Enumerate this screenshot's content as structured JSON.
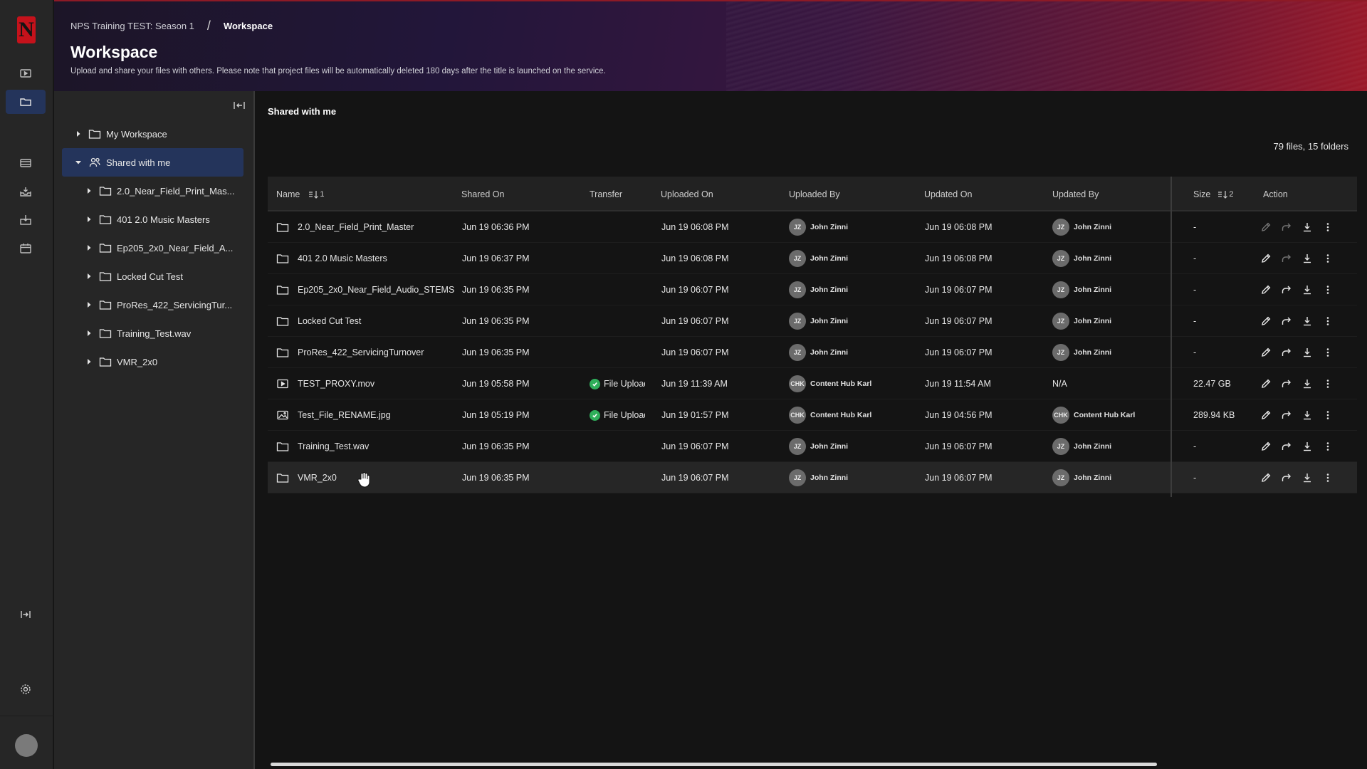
{
  "app": {
    "logo_letter": "N"
  },
  "rail": {
    "items": [
      {
        "icon": "play-icon"
      },
      {
        "icon": "folder-icon"
      },
      {
        "icon": "film-icon"
      },
      {
        "icon": "inbox-icon"
      },
      {
        "icon": "download-tray-icon"
      },
      {
        "icon": "calendar-icon"
      },
      {
        "icon": "expand-panel-icon"
      },
      {
        "icon": "gear-icon"
      }
    ]
  },
  "header": {
    "breadcrumb": [
      "NPS Training TEST: Season 1",
      "Workspace"
    ],
    "separator": "/",
    "title": "Workspace",
    "description": "Upload and share your files with others. Please note that project files will be automatically deleted 180 days after the title is launched on the service."
  },
  "tree": {
    "items": [
      {
        "label": "My Workspace",
        "level": 0,
        "expanded": false,
        "icon": "folder-icon"
      },
      {
        "label": "Shared with me",
        "level": 0,
        "expanded": true,
        "icon": "shared-users-icon",
        "selected": true
      },
      {
        "label": "2.0_Near_Field_Print_Mas...",
        "level": 1,
        "icon": "folder-icon"
      },
      {
        "label": "401 2.0 Music Masters",
        "level": 1,
        "icon": "folder-icon"
      },
      {
        "label": "Ep205_2x0_Near_Field_A...",
        "level": 1,
        "icon": "folder-icon"
      },
      {
        "label": "Locked Cut Test",
        "level": 1,
        "icon": "folder-icon"
      },
      {
        "label": "ProRes_422_ServicingTur...",
        "level": 1,
        "icon": "folder-icon"
      },
      {
        "label": "Training_Test.wav",
        "level": 1,
        "icon": "folder-icon"
      },
      {
        "label": "VMR_2x0",
        "level": 1,
        "icon": "folder-icon"
      }
    ]
  },
  "main": {
    "section_title": "Shared with me",
    "counts": "79 files, 15 folders",
    "columns": {
      "name": "Name",
      "name_sort": "1",
      "shared_on": "Shared On",
      "transfer": "Transfer",
      "uploaded_on": "Uploaded On",
      "uploaded_by": "Uploaded By",
      "updated_on": "Updated On",
      "updated_by": "Updated By",
      "size": "Size",
      "size_sort": "2",
      "action": "Action"
    },
    "rows": [
      {
        "type": "folder",
        "name": "2.0_Near_Field_Print_Master",
        "shared_on": "Jun 19 06:36 PM",
        "transfer": "",
        "uploaded_on": "Jun 19 06:08 PM",
        "uploaded_by_initials": "JZ",
        "uploaded_by": "John Zinni",
        "updated_on": "Jun 19 06:08 PM",
        "updated_by_initials": "JZ",
        "updated_by": "John Zinni",
        "size": "-",
        "edit_enabled": false,
        "share_enabled": false
      },
      {
        "type": "folder",
        "name": "401 2.0 Music Masters",
        "shared_on": "Jun 19 06:37 PM",
        "transfer": "",
        "uploaded_on": "Jun 19 06:08 PM",
        "uploaded_by_initials": "JZ",
        "uploaded_by": "John Zinni",
        "updated_on": "Jun 19 06:08 PM",
        "updated_by_initials": "JZ",
        "updated_by": "John Zinni",
        "size": "-",
        "edit_enabled": true,
        "share_enabled": false
      },
      {
        "type": "folder",
        "name": "Ep205_2x0_Near_Field_Audio_STEMS",
        "shared_on": "Jun 19 06:35 PM",
        "transfer": "",
        "uploaded_on": "Jun 19 06:07 PM",
        "uploaded_by_initials": "JZ",
        "uploaded_by": "John Zinni",
        "updated_on": "Jun 19 06:07 PM",
        "updated_by_initials": "JZ",
        "updated_by": "John Zinni",
        "size": "-",
        "edit_enabled": true,
        "share_enabled": true
      },
      {
        "type": "folder",
        "name": "Locked Cut Test",
        "shared_on": "Jun 19 06:35 PM",
        "transfer": "",
        "uploaded_on": "Jun 19 06:07 PM",
        "uploaded_by_initials": "JZ",
        "uploaded_by": "John Zinni",
        "updated_on": "Jun 19 06:07 PM",
        "updated_by_initials": "JZ",
        "updated_by": "John Zinni",
        "size": "-",
        "edit_enabled": true,
        "share_enabled": true
      },
      {
        "type": "folder",
        "name": "ProRes_422_ServicingTurnover",
        "shared_on": "Jun 19 06:35 PM",
        "transfer": "",
        "uploaded_on": "Jun 19 06:07 PM",
        "uploaded_by_initials": "JZ",
        "uploaded_by": "John Zinni",
        "updated_on": "Jun 19 06:07 PM",
        "updated_by_initials": "JZ",
        "updated_by": "John Zinni",
        "size": "-",
        "edit_enabled": true,
        "share_enabled": true
      },
      {
        "type": "video",
        "name": "TEST_PROXY.mov",
        "shared_on": "Jun 19 05:58 PM",
        "transfer": "File Upload",
        "uploaded_on": "Jun 19 11:39 AM",
        "uploaded_by_initials": "CHK",
        "uploaded_by": "Content Hub Karl",
        "updated_on": "Jun 19 11:54 AM",
        "updated_by_initials": "",
        "updated_by": "N/A",
        "size": "22.47 GB",
        "edit_enabled": true,
        "share_enabled": true
      },
      {
        "type": "image",
        "name": "Test_File_RENAME.jpg",
        "shared_on": "Jun 19 05:19 PM",
        "transfer": "File Upload",
        "uploaded_on": "Jun 19 01:57 PM",
        "uploaded_by_initials": "CHK",
        "uploaded_by": "Content Hub Karl",
        "updated_on": "Jun 19 04:56 PM",
        "updated_by_initials": "CHK",
        "updated_by": "Content Hub Karl",
        "size": "289.94 KB",
        "edit_enabled": true,
        "share_enabled": true
      },
      {
        "type": "folder",
        "name": "Training_Test.wav",
        "shared_on": "Jun 19 06:35 PM",
        "transfer": "",
        "uploaded_on": "Jun 19 06:07 PM",
        "uploaded_by_initials": "JZ",
        "uploaded_by": "John Zinni",
        "updated_on": "Jun 19 06:07 PM",
        "updated_by_initials": "JZ",
        "updated_by": "John Zinni",
        "size": "-",
        "edit_enabled": true,
        "share_enabled": true
      },
      {
        "type": "folder",
        "name": "VMR_2x0",
        "shared_on": "Jun 19 06:35 PM",
        "transfer": "",
        "uploaded_on": "Jun 19 06:07 PM",
        "uploaded_by_initials": "JZ",
        "uploaded_by": "John Zinni",
        "updated_on": "Jun 19 06:07 PM",
        "updated_by_initials": "JZ",
        "updated_by": "John Zinni",
        "size": "-",
        "edit_enabled": true,
        "share_enabled": true,
        "hover": true
      }
    ]
  },
  "colors": {
    "accent_selected": "#24345b",
    "success": "#2fae5a",
    "brand_red": "#c5121b"
  }
}
